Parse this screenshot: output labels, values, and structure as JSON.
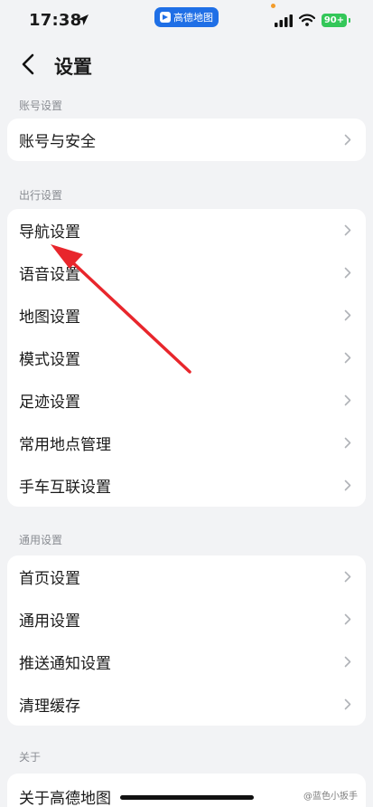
{
  "status_bar": {
    "time": "17:38",
    "app_pill": "高德地图",
    "battery": "90+"
  },
  "header": {
    "title": "设置"
  },
  "sections": [
    {
      "label": "账号设置",
      "items": [
        "账号与安全"
      ]
    },
    {
      "label": "出行设置",
      "items": [
        "导航设置",
        "语音设置",
        "地图设置",
        "模式设置",
        "足迹设置",
        "常用地点管理",
        "手车互联设置"
      ]
    },
    {
      "label": "通用设置",
      "items": [
        "首页设置",
        "通用设置",
        "推送通知设置",
        "清理缓存"
      ]
    },
    {
      "label": "关于",
      "items": [
        "关于高德地图"
      ]
    }
  ],
  "watermark": "@蓝色小扳手",
  "colors": {
    "accent": "#1f6fe6",
    "annotation_arrow": "#e8262c",
    "battery": "#34c759"
  }
}
